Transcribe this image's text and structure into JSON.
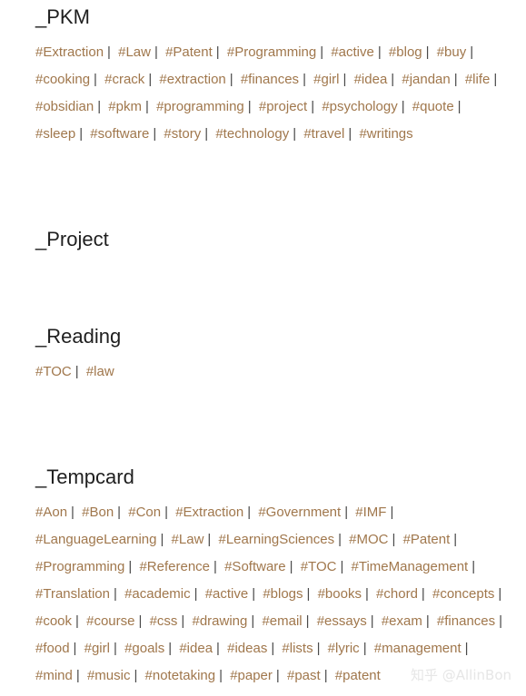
{
  "sections": [
    {
      "id": "sec-pkm",
      "title": "_PKM",
      "tags": [
        "#Extraction",
        "#Law",
        "#Patent",
        "#Programming",
        "#active",
        "#blog",
        "#buy",
        "#cooking",
        "#crack",
        "#extraction",
        "#finances",
        "#girl",
        "#idea",
        "#jandan",
        "#life",
        "#obsidian",
        "#pkm",
        "#programming",
        "#project",
        "#psychology",
        "#quote",
        "#sleep",
        "#software",
        "#story",
        "#technology",
        "#travel",
        "#writings"
      ]
    },
    {
      "id": "sec-project",
      "title": "_Project",
      "tags": []
    },
    {
      "id": "sec-reading",
      "title": "_Reading",
      "tags": [
        "#TOC",
        "#law"
      ]
    },
    {
      "id": "sec-tempcard",
      "title": "_Tempcard",
      "tags": [
        "#Aon",
        "#Bon",
        "#Con",
        "#Extraction",
        "#Government",
        "#IMF",
        "#LanguageLearning",
        "#Law",
        "#LearningSciences",
        "#MOC",
        "#Patent",
        "#Programming",
        "#Reference",
        "#Software",
        "#TOC",
        "#TimeManagement",
        "#Translation",
        "#academic",
        "#active",
        "#blogs",
        "#books",
        "#chord",
        "#concepts",
        "#cook",
        "#course",
        "#css",
        "#drawing",
        "#email",
        "#essays",
        "#exam",
        "#finances",
        "#food",
        "#girl",
        "#goals",
        "#idea",
        "#ideas",
        "#lists",
        "#lyric",
        "#management",
        "#mind",
        "#music",
        "#notetaking",
        "#paper",
        "#past",
        "#patent"
      ]
    }
  ],
  "separator": "|",
  "watermark": "知乎 @AllinBon",
  "colors": {
    "tag": "#a0774c",
    "title": "#1f1f1f",
    "separator": "#4a4a4a"
  }
}
